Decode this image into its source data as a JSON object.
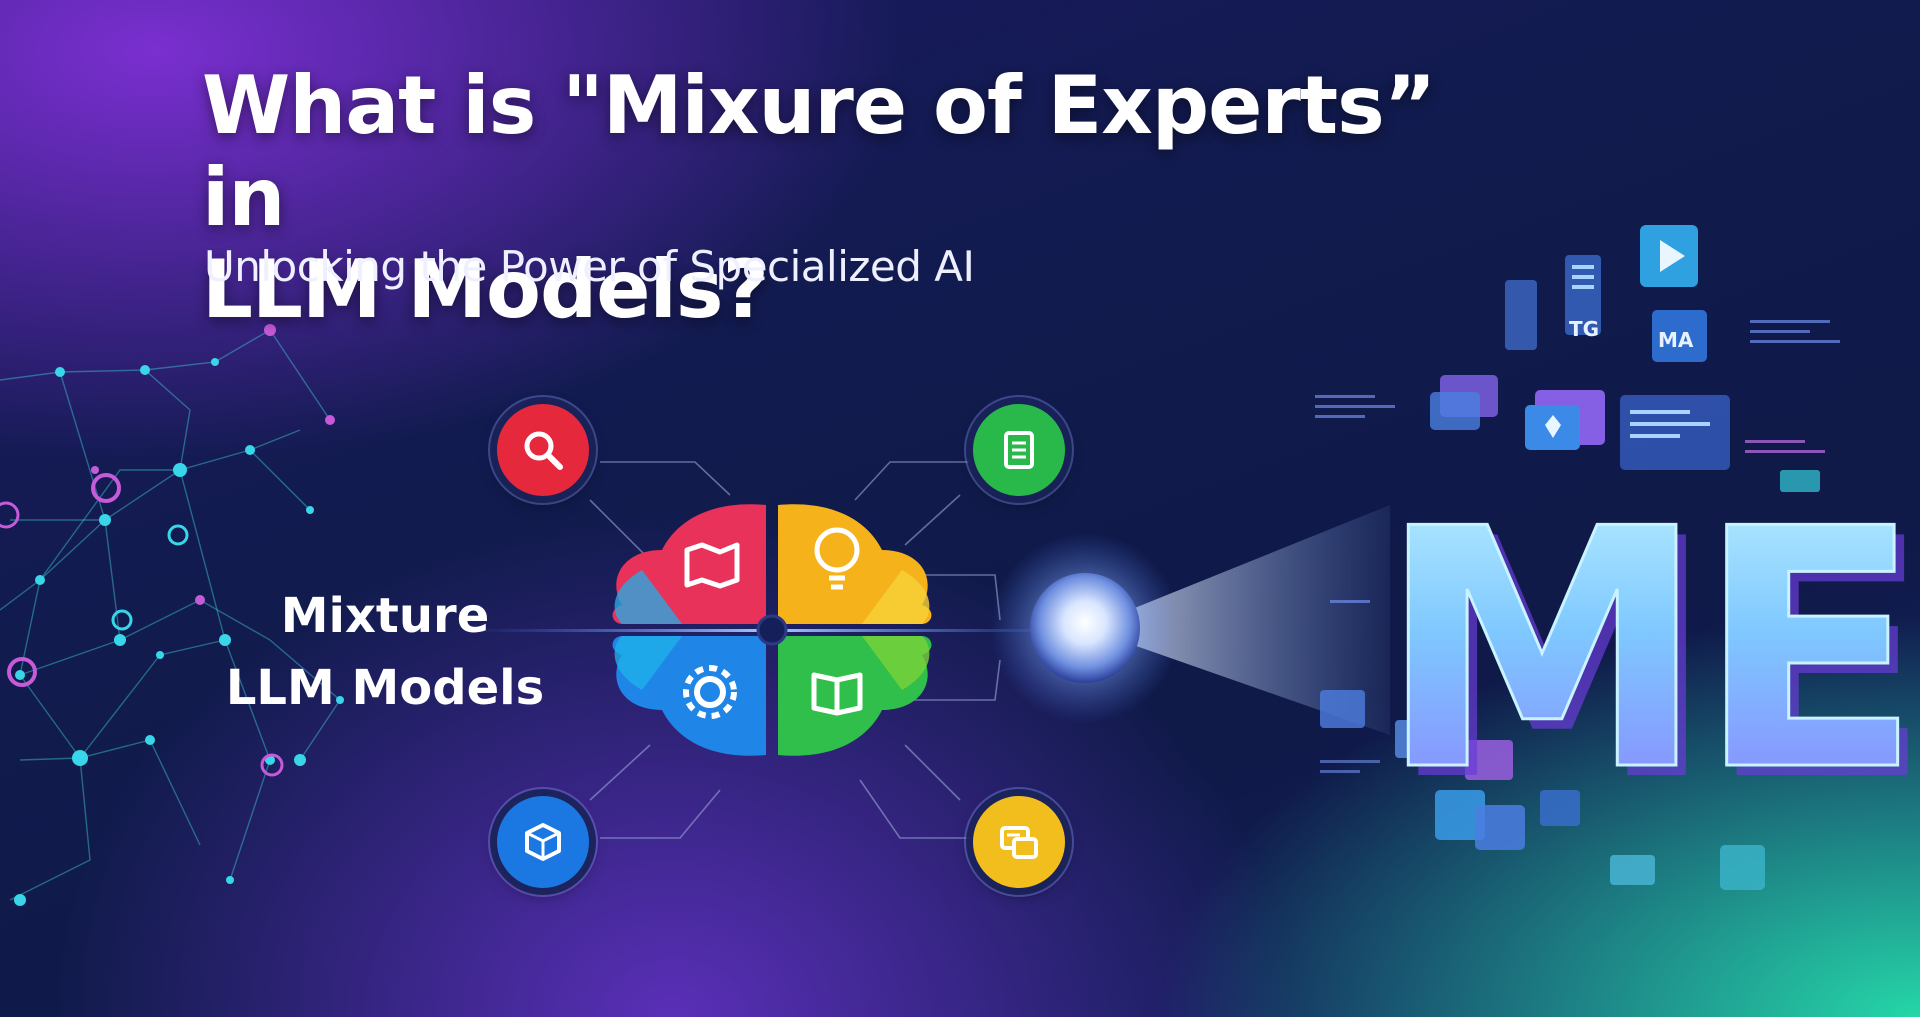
{
  "title": {
    "line1": "What is \"Mixure of Experts” in",
    "line2": "LLM Models?"
  },
  "subtitle": "Unlocking the Power of Specialized AI",
  "left_label": {
    "line1": "Mixture",
    "line2": "LLM Models"
  },
  "experts": [
    {
      "icon": "magnifier-icon",
      "color": "#e5283c"
    },
    {
      "icon": "document-icon",
      "color": "#28b94a"
    },
    {
      "icon": "cube-icon",
      "color": "#1b78e2"
    },
    {
      "icon": "chat-icon",
      "color": "#f2be1e"
    }
  ],
  "brain_segments": [
    {
      "icon": "map-icon",
      "color": "#e8325a"
    },
    {
      "icon": "lightbulb-icon",
      "color": "#f5b21a"
    },
    {
      "icon": "gear-icon",
      "color": "#1f86e8"
    },
    {
      "icon": "book-icon",
      "color": "#2fbf4a"
    }
  ],
  "logo_text": "ME",
  "panel_labels": {
    "tg": "TG",
    "ma": "MA"
  },
  "colors": {
    "accent_purple": "#7a2fd0",
    "accent_teal": "#25d6a8",
    "network": "#38d6e8",
    "network_pink": "#d04fd8"
  }
}
